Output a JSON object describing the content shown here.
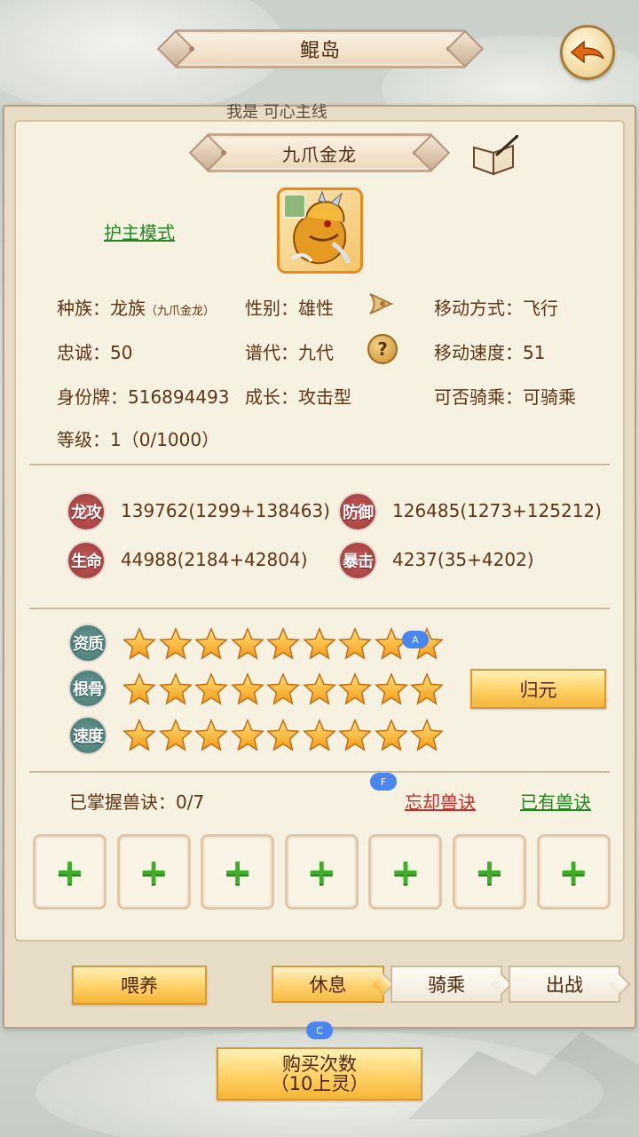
{
  "header": {
    "title": "鲲岛",
    "title_peek": "我是 可心主线"
  },
  "pet": {
    "name": "九爪金龙",
    "guard_mode_label": "护主模式",
    "race_label": "种族：龙族",
    "race_sub": "（九爪金龙）",
    "gender_label": "性别：雄性",
    "move_type_label": "移动方式：飞行",
    "loyalty_label": "忠诚：50",
    "generation_label": "谱代：九代",
    "move_speed_label": "移动速度：51",
    "id_label": "身份牌：516894493",
    "growth_label": "成长：攻击型",
    "ride_label": "可否骑乘：可骑乘",
    "level_label": "等级：1（0/1000）"
  },
  "stats": {
    "attack": {
      "badge": "龙攻",
      "value": "139762(1299+138463)"
    },
    "defense": {
      "badge": "防御",
      "value": "126485(1273+125212)"
    },
    "hp": {
      "badge": "生命",
      "value": "44988(2184+42804)"
    },
    "crit": {
      "badge": "暴击",
      "value": "4237(35+4202)"
    }
  },
  "ratings": {
    "aptitude": {
      "badge": "资质",
      "stars": 9,
      "max": 9
    },
    "bone": {
      "badge": "根骨",
      "stars": 9,
      "max": 9
    },
    "speed": {
      "badge": "速度",
      "stars": 9,
      "max": 9
    },
    "reset_label": "归元"
  },
  "skills": {
    "mastered_label": "已掌握兽诀：0/7",
    "forget_label": "忘却兽诀",
    "owned_label": "已有兽诀",
    "slot_count": 7
  },
  "actions": {
    "feed_label": "喂养",
    "tabs": [
      "休息",
      "骑乘",
      "出战"
    ],
    "active_tab": "休息"
  },
  "buy": {
    "line1": "购买次数",
    "line2": "（10上灵）"
  },
  "markers": {
    "a": "A",
    "f": "F",
    "c": "C"
  },
  "colors": {
    "link_green": "#1f8a1f",
    "link_red": "#c0302b",
    "accent_gold": "#ffd46b"
  }
}
